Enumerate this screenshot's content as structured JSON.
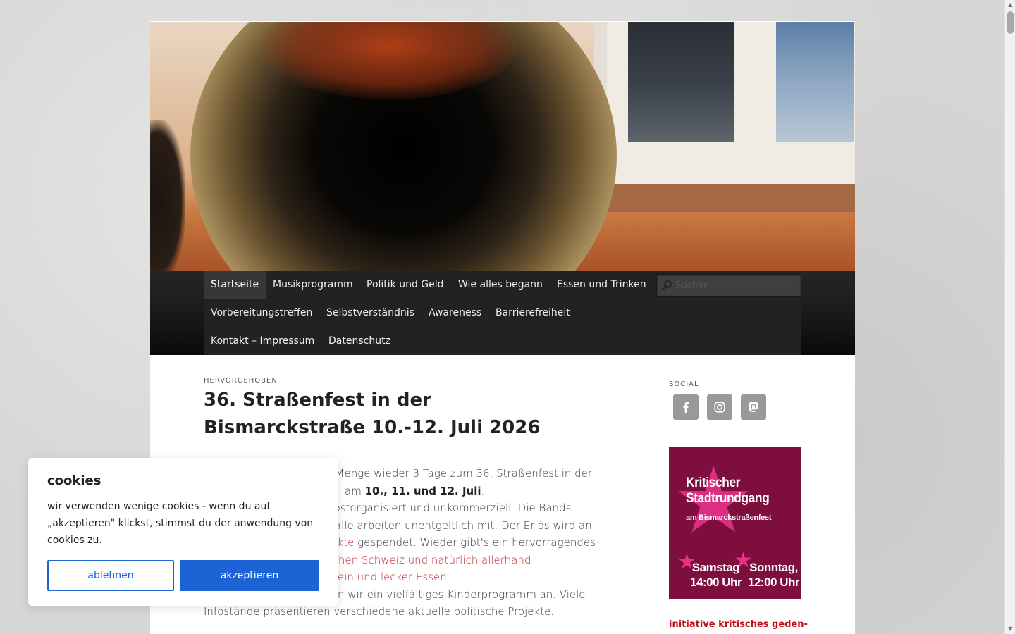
{
  "nav": {
    "items": [
      {
        "label": "Startseite"
      },
      {
        "label": "Musikprogramm"
      },
      {
        "label": "Politik und Geld"
      },
      {
        "label": "Wie alles begann"
      },
      {
        "label": "Essen und Trinken"
      },
      {
        "label": "Vorbereitungstreffen"
      },
      {
        "label": "Selbstverständnis"
      },
      {
        "label": "Awareness"
      },
      {
        "label": "Barrierefreiheit"
      },
      {
        "label": "Kontakt – Impressum"
      },
      {
        "label": "Datenschutz"
      }
    ],
    "active_index": 0,
    "search_placeholder": "Suchen"
  },
  "post": {
    "featured_label": "HERVORGEHOBEN",
    "title": "36. Straßenfest in der Bismarckstraße 10.-12. Juli 2026",
    "line1": "de Menge wieder 3 Tage zum 36. Straßenfest in der",
    "line2_pre": "am ",
    "line2_bold": "10., 11. und 12. Juli",
    "line2_post": ".",
    "line3": "selbstorganisiert und unkommerziell. Die Bands",
    "line4": "l alle arbeiten unentgeltlich mit. Der Erlös wird an",
    "line5_red": "ojekte",
    "line5_post": " gespendet. Wieder gibt's ein hervorragendes",
    "line6_red": "hen Schweiz und natürlich allerhand",
    "line7_red": "ein und lecker Essen.",
    "line8": "n wir ein vielfältiges Kinderprogramm an. Viele",
    "line9": "Infostände präsentieren verschiedene aktuelle politische Projekte."
  },
  "sidebar": {
    "social_label": "SOCIAL",
    "social_icons": [
      "facebook-icon",
      "instagram-icon",
      "mastodon-icon"
    ],
    "promo": {
      "title_line1": "Kritischer",
      "title_line2": "Stadtrundgang",
      "subtitle": "am Bismarckstraßenfest",
      "day1": "Samstag",
      "time1": "14:00 Uhr",
      "day2": "Sonntag,",
      "time2": "12:00 Uhr"
    },
    "link_text": "initiative kritisches geden-"
  },
  "cookie": {
    "title": "cookies",
    "text": "wir verwenden wenige cookies - wenn du auf „akzeptieren\" klickst, stimmst du der anwendung von cookies zu.",
    "decline_label": "ablehnen",
    "accept_label": "akzeptieren"
  },
  "colors": {
    "accent_blue": "#1e63d6",
    "link_red": "#c0282d",
    "promo_bg": "#7d0e3e",
    "promo_star": "#e6338a"
  }
}
